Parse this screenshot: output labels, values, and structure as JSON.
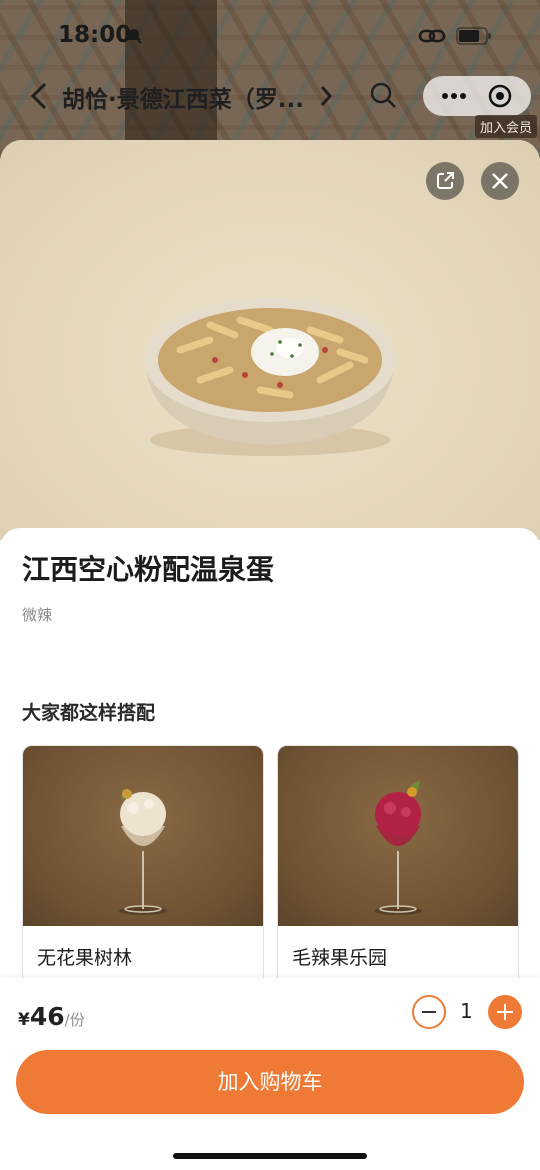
{
  "status_bar": {
    "time": "18:00"
  },
  "nav": {
    "shop_title": "胡恰·景德江西菜（罗...",
    "member_tag": "加入会员"
  },
  "dish": {
    "name": "江西空心粉配温泉蛋",
    "tag": "微辣"
  },
  "pairing": {
    "title": "大家都这样搭配",
    "items": [
      {
        "name": "无花果树林"
      },
      {
        "name": "毛辣果乐园"
      }
    ]
  },
  "order": {
    "currency": "¥",
    "price": "46",
    "unit": "/份",
    "quantity": "1",
    "add_to_cart": "加入购物车"
  },
  "colors": {
    "accent": "#ef7a35"
  }
}
